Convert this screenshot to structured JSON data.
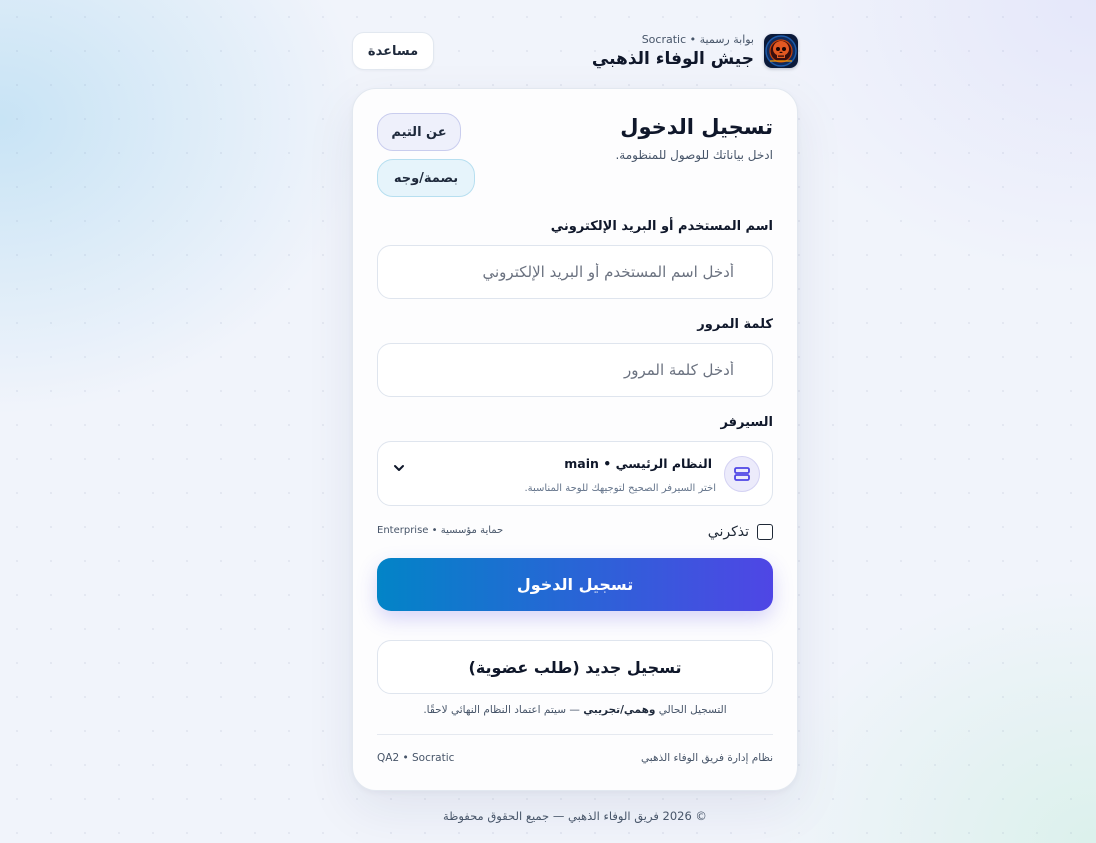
{
  "header": {
    "subtitle": "بوابة رسمية • Socratic",
    "title": "جيش الوفاء الذهبي",
    "help_label": "مساعدة"
  },
  "card": {
    "title": "تسجيل الدخول",
    "subtitle": "ادخل بياناتك للوصول للمنظومة.",
    "about_team_label": "عن التيم",
    "biometric_label": "بصمة/وجه"
  },
  "form": {
    "username_label": "اسم المستخدم أو البريد الإلكتروني",
    "username_placeholder": "أدخل اسم المستخدم أو البريد الإلكتروني",
    "username_value": "",
    "password_label": "كلمة المرور",
    "password_placeholder": "أدخل كلمة المرور",
    "password_value": "",
    "server_label": "السيرفر",
    "server_selected": "النظام الرئيسي • main",
    "server_hint": "اختر السيرفر الصحيح لتوجيهك للوحة المناسبة.",
    "remember_label": "تذكرني",
    "remember_checked": false,
    "security_badge": "حماية مؤسسية • Enterprise",
    "login_label": "تسجيل الدخول",
    "register_label": "تسجيل جديد (طلب عضوية)",
    "note_prefix": "التسجيل الحالي",
    "note_bold": "وهمي/تجريبي",
    "note_suffix": "— سيتم اعتماد النظام النهائي لاحقًا."
  },
  "card_footer": {
    "system_name": "نظام إدارة فريق الوفاء الذهبي",
    "version": "QA2 • Socratic"
  },
  "copyright": "© 2026 فريق الوفاء الذهبي — جميع الحقوق محفوظة",
  "icons": {
    "logo": "skull-emblem-logo",
    "server": "server-icon",
    "chevron": "chevron-down-icon"
  },
  "colors": {
    "primary_start": "#0284c7",
    "primary_end": "#4f46e5",
    "text": "#0f172a",
    "muted": "#475569",
    "background": "#f1f4fb"
  }
}
